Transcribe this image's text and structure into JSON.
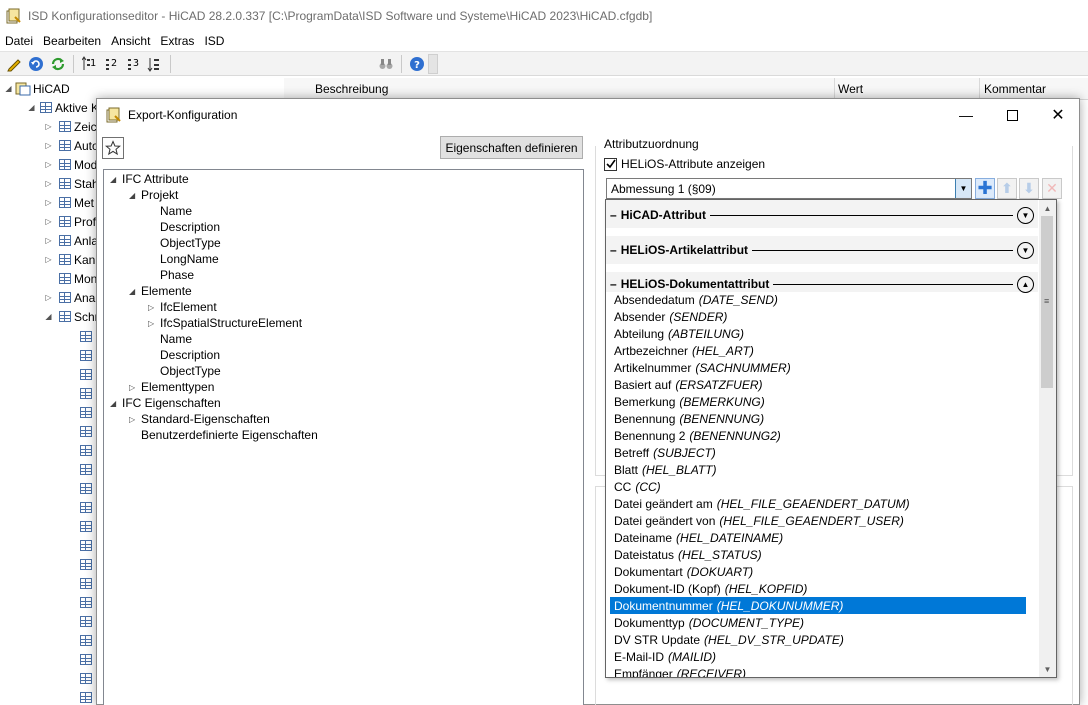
{
  "app": {
    "title": "ISD Konfigurationseditor - HiCAD 28.2.0.337 [C:\\ProgramData\\ISD Software und Systeme\\HiCAD 2023\\HiCAD.cfgdb]"
  },
  "menu": [
    "Datei",
    "Bearbeiten",
    "Ansicht",
    "Extras",
    "ISD"
  ],
  "toolbar": {
    "btn1": "1",
    "btn2": "2",
    "btn3": "3"
  },
  "bg_tree": {
    "root": "HiCAD",
    "active": "Aktive K",
    "items": [
      "Zeic",
      "Auto",
      "Mod",
      "Stah",
      "Met",
      "Prof",
      "Anla",
      "Kan",
      "Mon",
      "Ana",
      "Schr"
    ]
  },
  "bg_header": {
    "col1": "Beschreibung",
    "col2": "Wert",
    "col3": "Kommentar"
  },
  "dialog": {
    "title": "Export-Konfiguration",
    "define_button": "Eigenschaften definieren",
    "attr_label": "Attributzuordnung",
    "helios_check": "HELiOS-Attribute anzeigen",
    "combo_value": "Abmessung 1 (§09)"
  },
  "tree": {
    "ifc_attr": "IFC Attribute",
    "projekt": "Projekt",
    "projekt_children": [
      "Name",
      "Description",
      "ObjectType",
      "LongName",
      "Phase"
    ],
    "elemente": "Elemente",
    "ifc_element": "IfcElement",
    "ifc_spatial": "IfcSpatialStructureElement",
    "elemente_children": [
      "Name",
      "Description",
      "ObjectType"
    ],
    "elementtypen": "Elementtypen",
    "ifc_eig": "IFC Eigenschaften",
    "standard": "Standard-Eigenschaften",
    "benutzer": "Benutzerdefinierte Eigenschaften"
  },
  "popup": {
    "groups": [
      "HiCAD-Attribut",
      "HELiOS-Artikelattribut",
      "HELiOS-Dokumentattribut"
    ],
    "options": [
      {
        "name": "Absendedatum",
        "code": "(DATE_SEND)"
      },
      {
        "name": "Absender",
        "code": "(SENDER)"
      },
      {
        "name": "Abteilung",
        "code": "(ABTEILUNG)"
      },
      {
        "name": "Artbezeichner",
        "code": "(HEL_ART)"
      },
      {
        "name": "Artikelnummer",
        "code": "(SACHNUMMER)"
      },
      {
        "name": "Basiert auf",
        "code": "(ERSATZFUER)"
      },
      {
        "name": "Bemerkung",
        "code": "(BEMERKUNG)"
      },
      {
        "name": "Benennung",
        "code": "(BENENNUNG)"
      },
      {
        "name": "Benennung 2",
        "code": "(BENENNUNG2)"
      },
      {
        "name": "Betreff",
        "code": "(SUBJECT)"
      },
      {
        "name": "Blatt",
        "code": "(HEL_BLATT)"
      },
      {
        "name": "CC",
        "code": "(CC)"
      },
      {
        "name": "Datei geändert am",
        "code": "(HEL_FILE_GEAENDERT_DATUM)"
      },
      {
        "name": "Datei geändert von",
        "code": "(HEL_FILE_GEAENDERT_USER)"
      },
      {
        "name": "Dateiname",
        "code": "(HEL_DATEINAME)"
      },
      {
        "name": "Dateistatus",
        "code": "(HEL_STATUS)"
      },
      {
        "name": "Dokumentart",
        "code": "(DOKUART)"
      },
      {
        "name": "Dokument-ID (Kopf)",
        "code": "(HEL_KOPFID)"
      },
      {
        "name": "Dokumentnummer",
        "code": "(HEL_DOKUNUMMER)"
      },
      {
        "name": "Dokumenttyp",
        "code": "(DOCUMENT_TYPE)"
      },
      {
        "name": "DV STR Update",
        "code": "(HEL_DV_STR_UPDATE)"
      },
      {
        "name": "E-Mail-ID",
        "code": "(MAILID)"
      },
      {
        "name": "Empfänger",
        "code": "(RECEIVER)"
      }
    ],
    "selected": "Dokumentnummer"
  }
}
